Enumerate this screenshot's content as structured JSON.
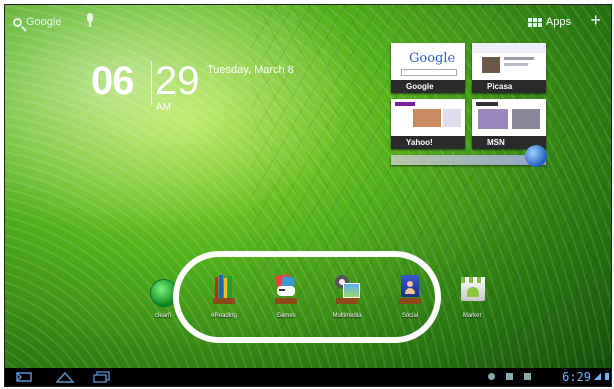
{
  "search": {
    "label": "Google"
  },
  "apps_button": {
    "label": "Apps"
  },
  "clock": {
    "hour": "06",
    "minute": "29",
    "ampm": "AM",
    "date": "Tuesday, March 8"
  },
  "thumbnails": [
    {
      "label": "Google",
      "page_logo": "Google"
    },
    {
      "label": "Picasa"
    },
    {
      "label": "Yahoo!"
    },
    {
      "label": "MSN"
    }
  ],
  "dock": [
    {
      "label": "clearfi",
      "icon": "clearfi-icon"
    },
    {
      "label": "eReading",
      "icon": "ereading-icon"
    },
    {
      "label": "Games",
      "icon": "games-icon"
    },
    {
      "label": "Multimedia",
      "icon": "multimedia-icon"
    },
    {
      "label": "Social",
      "icon": "social-icon"
    },
    {
      "label": "Market",
      "icon": "market-icon"
    }
  ],
  "status_bar": {
    "time": "6:29"
  },
  "colors": {
    "wallpaper_green": "#55b31c",
    "nav_bar": "#000000",
    "status_blue": "#6bb4ff"
  }
}
